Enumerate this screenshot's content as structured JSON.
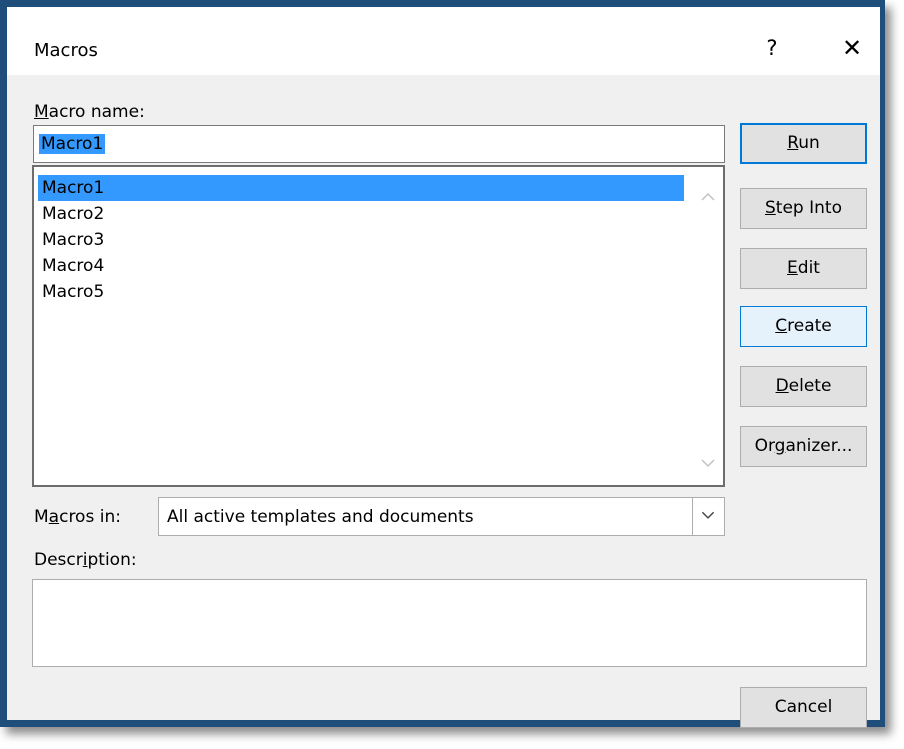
{
  "dialog": {
    "title": "Macros"
  },
  "titlebar": {
    "help_glyph": "?",
    "close_glyph": "✕"
  },
  "macro_name": {
    "label_accel": "M",
    "label_rest": "acro name:",
    "value": "Macro1"
  },
  "macro_list": {
    "items": [
      "Macro1",
      "Macro2",
      "Macro3",
      "Macro4",
      "Macro5"
    ],
    "selected": "Macro1"
  },
  "macros_in": {
    "label_pre": "M",
    "label_accel": "a",
    "label_post": "cros in:",
    "value": "All active templates and documents"
  },
  "description": {
    "label_pre": "Descr",
    "label_accel": "i",
    "label_post": "ption:",
    "value": ""
  },
  "buttons": {
    "run": {
      "accel": "R",
      "rest": "un"
    },
    "step_into": {
      "accel": "S",
      "rest": "tep Into"
    },
    "edit": {
      "accel": "E",
      "rest": "dit"
    },
    "create": {
      "accel": "C",
      "rest": "reate"
    },
    "delete": {
      "accel": "D",
      "rest": "elete"
    },
    "organizer": {
      "pre": "Or",
      "accel": "g",
      "post": "anizer..."
    },
    "cancel": {
      "label": "Cancel"
    }
  },
  "colors": {
    "window_border": "#1e4e79",
    "selection": "#3399ff",
    "default_button_border": "#0078d7",
    "dialog_background": "#f0f0f0"
  }
}
